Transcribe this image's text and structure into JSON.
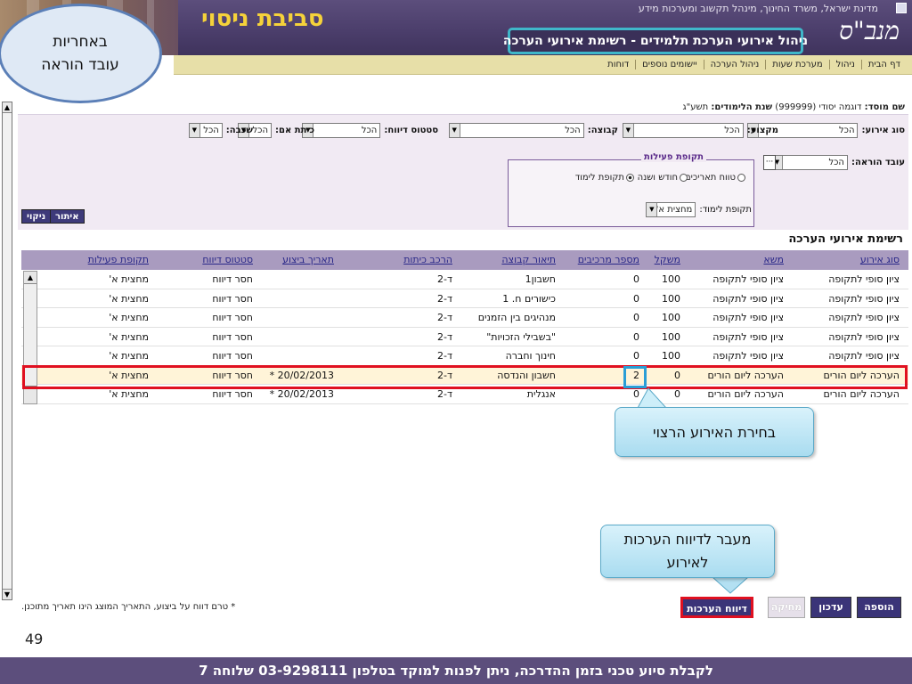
{
  "header": {
    "top_text": "מדינת ישראל, משרד החינוך, מינהל תקשוב ומערכות מידע",
    "logo": "מנב\"ס",
    "environment": "סביבת ניסוי",
    "title": "ניהול אירועי הערכת תלמידים - רשימת אירועי הערכה"
  },
  "menu": {
    "items": [
      "דף הבית",
      "ניהול",
      "מערכת שעות",
      "ניהול הערכה",
      "יישומים נוספים",
      "דוחות"
    ]
  },
  "annotation_oval": {
    "line1": "באחריות",
    "line2": "עובד הוראה"
  },
  "school": {
    "label": "שם מוסד:",
    "value": "דוגמה יסודי (999999)",
    "year_label": "שנת הלימודים:",
    "year_value": "תשע\"ג"
  },
  "filters": {
    "event_type": {
      "label": "סוג אירוע:",
      "value": "הכל"
    },
    "subject": {
      "label": "מקצוע:",
      "value": "הכל"
    },
    "group": {
      "label": "קבוצה:",
      "value": "הכל"
    },
    "report_status": {
      "label": "סטטוס דיווח:",
      "value": "הכל"
    },
    "class": {
      "label": "כיתת אם:",
      "value": "הכל"
    },
    "grade": {
      "label": "שכבה:",
      "value": "הכל"
    },
    "teacher": {
      "label": "עובד הוראה:",
      "value": "הכל"
    },
    "period_legend": "תקופת פעילות",
    "radio_range": "טווח תאריכים",
    "radio_month": "חודש ושנה",
    "radio_period": "תקופת לימוד",
    "study_period_label": "תקופת לימוד:",
    "study_period_value": "מחצית א'",
    "search_button": "איתור",
    "clear_button": "ניקוי"
  },
  "table": {
    "title": "רשימת אירועי הערכה",
    "columns": [
      "סוג אירוע",
      "משא",
      "משקל",
      "מספר מרכיבים",
      "תיאור קבוצה",
      "הרכב כיתות",
      "תאריך ביצוע",
      "סטטוס דיווח",
      "תקופת פעילות"
    ],
    "rows": [
      {
        "type": "ציון סופי לתקופה",
        "subject": "ציון סופי לתקופה",
        "weight": "100",
        "components": "0",
        "group": "חשבון1",
        "classes": "ד-2",
        "date": "",
        "status": "חסר דיווח",
        "period": "מחצית א'"
      },
      {
        "type": "ציון סופי לתקופה",
        "subject": "ציון סופי לתקופה",
        "weight": "100",
        "components": "0",
        "group": "כישורים ח. 1",
        "classes": "ד-2",
        "date": "",
        "status": "חסר דיווח",
        "period": "מחצית א'"
      },
      {
        "type": "ציון סופי לתקופה",
        "subject": "ציון סופי לתקופה",
        "weight": "100",
        "components": "0",
        "group": "מנהיגים בין הזמנים",
        "classes": "ד-2",
        "date": "",
        "status": "חסר דיווח",
        "period": "מחצית א'"
      },
      {
        "type": "ציון סופי לתקופה",
        "subject": "ציון סופי לתקופה",
        "weight": "100",
        "components": "0",
        "group": "\"בשבילי הזכויות\"",
        "classes": "ד-2",
        "date": "",
        "status": "חסר דיווח",
        "period": "מחצית א'"
      },
      {
        "type": "ציון סופי לתקופה",
        "subject": "ציון סופי לתקופה",
        "weight": "100",
        "components": "0",
        "group": "חינוך וחברה",
        "classes": "ד-2",
        "date": "",
        "status": "חסר דיווח",
        "period": "מחצית א'"
      },
      {
        "type": "הערכה ליום הורים",
        "subject": "הערכה ליום הורים",
        "weight": "0",
        "components": "2",
        "group": "חשבון והנדסה",
        "classes": "ד-2",
        "date": "20/02/2013 *",
        "status": "חסר דיווח",
        "period": "מחצית א'"
      },
      {
        "type": "הערכה ליום הורים",
        "subject": "הערכה ליום הורים",
        "weight": "0",
        "components": "0",
        "group": "אנגלית",
        "classes": "ד-2",
        "date": "20/02/2013 *",
        "status": "חסר דיווח",
        "period": "מחצית א'"
      }
    ],
    "selected_row": 5
  },
  "callouts": {
    "choose_event": "בחירת האירוע הרצוי",
    "go_to_report_line1": "מעבר לדיווח הערכות",
    "go_to_report_line2": "לאירוע"
  },
  "footer": {
    "note": "* טרם דווח על ביצוע, התאריך המוצג הינו תאריך מתוכנן.",
    "add_button": "הוספה",
    "update_button": "עדכון",
    "delete_button": "מחיקה",
    "report_button": "דיווח הערכות"
  },
  "slide": {
    "page_number": "49",
    "support_text": "לקבלת סיוע טכני בזמן ההדרכה, ניתן לפנות למוקד בטלפון 03-9298111 שלוחה 7"
  },
  "colors": {
    "header": "#4a3d6a",
    "menu": "#e7dfa8",
    "highlight_red": "#e01020",
    "highlight_blue": "#2a9ed6",
    "env_title": "#f5d23a"
  }
}
